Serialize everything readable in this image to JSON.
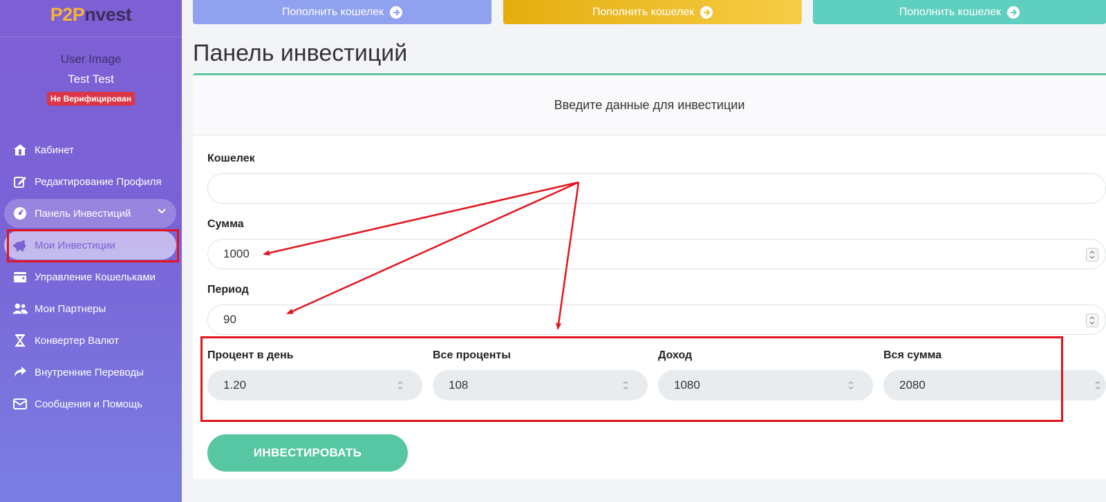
{
  "sidebar": {
    "logo_p2p": "P2P",
    "logo_rest": "nvest",
    "user_image": "User Image",
    "user_name": "Test Test",
    "badge": "Не Верифицирован",
    "items": [
      {
        "label": "Кабинет",
        "icon": "home-icon"
      },
      {
        "label": "Редактирование Профиля",
        "icon": "edit-icon"
      },
      {
        "label": "Панель Инвестиций",
        "icon": "dashboard-icon"
      },
      {
        "label": "Мои Инвестиции",
        "icon": "piggy-bank-icon"
      },
      {
        "label": "Управление Кошельками",
        "icon": "wallet-icon"
      },
      {
        "label": "Мои Партнеры",
        "icon": "users-icon"
      },
      {
        "label": "Конвертер Валют",
        "icon": "hourglass-icon"
      },
      {
        "label": "Внутренние Переводы",
        "icon": "share-icon"
      },
      {
        "label": "Сообщения и Помощь",
        "icon": "envelope-icon"
      }
    ]
  },
  "top_buttons": [
    {
      "label": "Пополнить кошелек",
      "color": "#8fa1ef"
    },
    {
      "label": "Пополнить кошелек",
      "color": "#f0be2b"
    },
    {
      "label": "Пополнить кошелек",
      "color": "#5fcfbf"
    }
  ],
  "page_title": "Панель инвестиций",
  "card": {
    "header": "Введите данные для инвестиции",
    "wallet": {
      "label": "Кошелек",
      "value": ""
    },
    "amount": {
      "label": "Сумма",
      "value": "1000"
    },
    "period": {
      "label": "Период",
      "value": "90"
    },
    "daily_percent": {
      "label": "Процент в день",
      "value": "1.20"
    },
    "total_percent": {
      "label": "Все проценты",
      "value": "108"
    },
    "income": {
      "label": "Доход",
      "value": "1080"
    },
    "total_sum": {
      "label": "Вся сумма",
      "value": "2080"
    },
    "submit": "ИНВЕСТИРОВАТЬ"
  },
  "colors": {
    "accent_green": "#56c7a2",
    "sidebar_purple": "#7e5fd4",
    "annotation_red": "#e3131b"
  }
}
